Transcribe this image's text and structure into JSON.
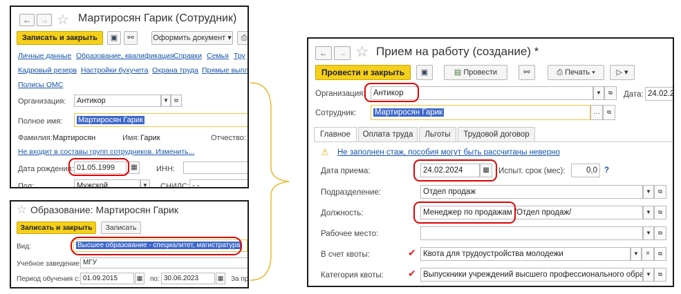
{
  "employee_window": {
    "title": "Мартиросян Гарик (Сотрудник)",
    "save_close": "Записать и закрыть",
    "make_doc": "Оформить документ",
    "links_row1": [
      "Личные данные",
      "Образование, квалификация",
      "Справки",
      "Семья",
      "Тру"
    ],
    "links_row2": [
      "Кадровый резерв",
      "Настройки бухучета",
      "Охрана труда",
      "Прямые выпл"
    ],
    "links_row3": [
      "Полисы ОМС"
    ],
    "org_label": "Организация:",
    "org_value": "Антикор",
    "fullname_label": "Полное имя:",
    "fullname_value": "Мартиросян Гарик",
    "surname_label": "Фамилия:",
    "surname_value": "Мартиросян",
    "name_label": "Имя:",
    "name_value": "Гарик",
    "patronymic_label": "Отчество:",
    "groups_link": "Не входит в составы групп сотрудников. Изменить...",
    "birth_label": "Дата рождения:",
    "birth_value": "01.05.1999",
    "inn_label": "ИНН:",
    "sex_label": "Пол:",
    "sex_value": "Мужской",
    "snils_label": "СНИЛС:",
    "snils_value": "-   -"
  },
  "education_window": {
    "title": "Образование: Мартиросян Гарик",
    "save_close": "Записать и закрыть",
    "save": "Записать",
    "type_label": "Вид:",
    "type_value": "Высшее образование - специалитет, магистратура",
    "institution_label": "Учебное заведение:",
    "institution_value": "МГУ",
    "period_label": "Период обучения с:",
    "period_from": "01.09.2015",
    "period_to_label": "по:",
    "period_to": "30.06.2023",
    "extra_label": "За пр"
  },
  "hire_window": {
    "title": "Прием на работу (создание) *",
    "post_close": "Провести и закрыть",
    "post": "Провести",
    "print": "Печать",
    "org_label": "Организация:",
    "org_value": "Антикор",
    "date_label": "Дата:",
    "date_value": "24.02.2",
    "employee_label": "Сотрудник:",
    "employee_value": "Мартиросян Гарик",
    "tabs": [
      "Главное",
      "Оплата труда",
      "Льготы",
      "Трудовой договор"
    ],
    "warning": "Не заполнен стаж, пособия могут быть рассчитаны неверно",
    "hire_date_label": "Дата приема:",
    "hire_date_value": "24.02.2024",
    "probation_label": "Испыт. срок (мес):",
    "probation_value": "0,0",
    "help": "?",
    "department_label": "Подразделение:",
    "department_value": "Отдел продаж",
    "position_label": "Должность:",
    "position_value": "Менеджер по продажам",
    "position_suffix": "/Отдел продаж/",
    "workplace_label": "Рабочее место:",
    "quota_label": "В счет квоты:",
    "quota_value": "Квота для трудоустройства молодежи",
    "quota_cat_label": "Категория квоты:",
    "quota_cat_value": "Выпускники учреждений высшего профессионального обра"
  },
  "colors": {
    "accent": "#f5d01a",
    "link": "#1652a8",
    "highlight": "#e00000",
    "bracket": "#e8b830"
  }
}
